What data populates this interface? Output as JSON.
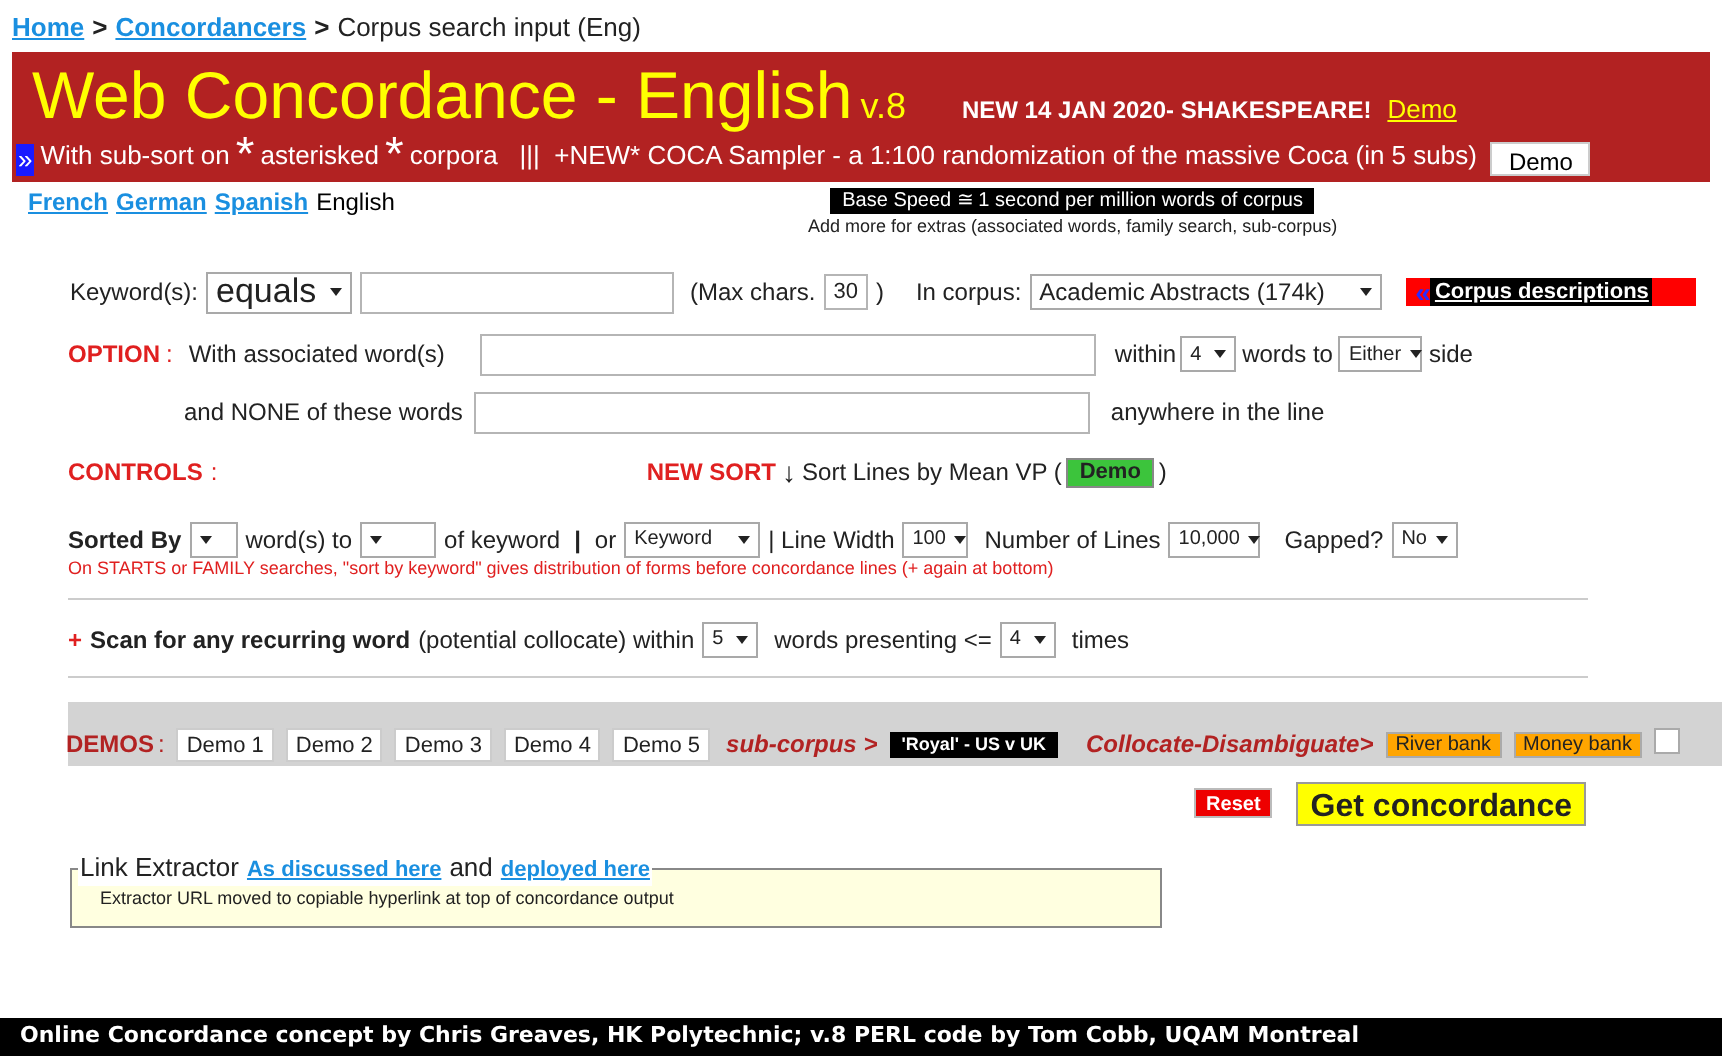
{
  "breadcrumb": [
    {
      "kind": "link",
      "text": "Home"
    },
    {
      "kind": "sep",
      "text": ">"
    },
    {
      "kind": "link",
      "text": "Concordancers"
    },
    {
      "kind": "sep",
      "text": ">"
    },
    {
      "kind": "text",
      "text": "Corpus search input (Eng)"
    }
  ],
  "header": {
    "title": "Web Concordance - English",
    "version": "v.8",
    "news": "NEW 14 JAN 2020- SHAKESPEARE!",
    "news_link": "Demo",
    "subline": [
      {
        "kind": "marker",
        "text": "»"
      },
      {
        "kind": "text",
        "text": "With sub-sort on"
      },
      {
        "kind": "big",
        "text": "*"
      },
      {
        "kind": "text",
        "text": "asterisked"
      },
      {
        "kind": "big",
        "text": "*"
      },
      {
        "kind": "text",
        "text": "corpora   |||  +NEW* COCA Sampler - a 1:100 randomization of the massive Coca (in 5 subs)"
      },
      {
        "kind": "button",
        "text": "Demo"
      }
    ]
  },
  "languages": [
    {
      "label": "French",
      "selected": false
    },
    {
      "label": "German",
      "selected": false
    },
    {
      "label": "Spanish",
      "selected": false
    },
    {
      "label": "English",
      "selected": true
    }
  ],
  "speed_badge": "Base Speed ≅ 1 second per million words of corpus",
  "speed_note": "Add more for extras (associated words, family search, sub-corpus)",
  "keyword_row": {
    "label": "Keyword(s):",
    "match": "equals",
    "max_label": "(Max chars.",
    "max_value": "30",
    "max_close": ")",
    "corpus_label": "In corpus:",
    "corpus": "Academic Abstracts (174k)",
    "descriptions_icon": "«",
    "descriptions": "Corpus descriptions"
  },
  "option": {
    "label": "OPTION",
    "colon": ":",
    "assoc_label": "With associated word(s)",
    "within": "within",
    "within_value": "4",
    "words_to": "words to",
    "side_value": "Either",
    "side": "side",
    "none_label": "and NONE of these words",
    "none_suffix": "anywhere in the line"
  },
  "controls": {
    "label": "CONTROLS",
    "colon": ":",
    "new_sort": "NEW SORT",
    "arrow": "↓",
    "sort_text": "Sort Lines by Mean VP (",
    "demo": "Demo",
    "close": ")"
  },
  "sorted": {
    "label": "Sorted By",
    "words_to": "word(s) to",
    "of_keyword": "of keyword",
    "bar": "|",
    "or": "or",
    "sort_value": "Keyword",
    "line_width": "| Line Width",
    "line_width_value": "100",
    "lines": "Number of Lines",
    "lines_value": "10,000",
    "gapped": "Gapped?",
    "gapped_value": "No",
    "note": "On STARTS or FAMILY searches, \"sort by keyword\" gives distribution of forms before concordance lines (+ again at bottom)"
  },
  "scan": {
    "plus": "+",
    "bold": "Scan for any recurring word",
    "text": "(potential collocate) within",
    "within_value": "5",
    "presenting": "words presenting <=",
    "times_value": "4",
    "times": "times"
  },
  "demos": {
    "label": "DEMOS",
    "colon": ":",
    "buttons": [
      "Demo 1",
      "Demo 2",
      "Demo 3",
      "Demo 4",
      "Demo 5"
    ],
    "subcorpus": "sub-corpus >",
    "subcorpus_button": "'Royal' - US v UK",
    "collocate": "Collocate-Disambiguate>",
    "collocate_buttons": [
      "River bank",
      "Money bank"
    ],
    "checked": false
  },
  "actions": {
    "reset": "Reset",
    "submit": "Get concordance"
  },
  "link_extractor": {
    "title": "Link Extractor",
    "link1": "As discussed here",
    "and": "and",
    "link2": "deployed here",
    "text": "Extractor URL moved to copiable hyperlink at top of concordance output"
  },
  "footer": "Online Concordance concept by Chris Greaves, HK Polytechnic; v.8 PERL code by Tom Cobb, UQAM Montreal"
}
